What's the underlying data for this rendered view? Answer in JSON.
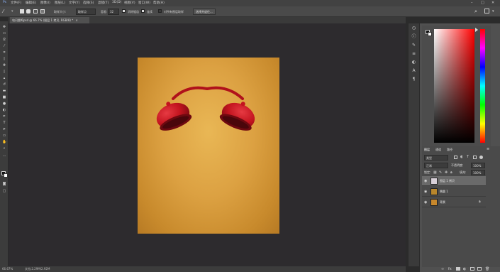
{
  "menubar": {
    "items": [
      "文件(F)",
      "编辑(E)",
      "图像(I)",
      "图层(L)",
      "文字(Y)",
      "选择(S)",
      "滤镜(T)",
      "3D(D)",
      "视图(V)",
      "窗口(W)",
      "帮助(H)"
    ],
    "minimize": "–",
    "maximize": "□",
    "close": "✕"
  },
  "options": {
    "sample_size_label": "取样大小:",
    "sample_size_value": "取样点",
    "tolerance_label": "容差:",
    "tolerance_value": "32",
    "antialias_label": "消除锯齿",
    "contiguous_label": "连续",
    "all_layers_label": "对所有图层取样",
    "refine_button": "选择并遮住..."
  },
  "document": {
    "tab_title": "电闪雷鸣psd @ 66.7% (图层 1 拷贝, RGB/8) *",
    "tab_close": "×"
  },
  "status": {
    "zoom": "66.67%",
    "doc_size": "文档:2.29M/2.92M"
  },
  "layers_panel": {
    "tabs": [
      "图层",
      "通道",
      "路径"
    ],
    "kind_filter": "类型",
    "blend_mode": "正常",
    "opacity_label": "不透明度:",
    "opacity_value": "100%",
    "lock_label": "锁定:",
    "fill_label": "填充:",
    "fill_value": "100%",
    "layers": [
      {
        "name": "图层 1 拷贝",
        "thumb_color": "#d8d0d8",
        "selected": true
      },
      {
        "name": "椭圆 1",
        "thumb_color": "#b8862c",
        "selected": false
      },
      {
        "name": "背景",
        "thumb_color": "#c8882c",
        "selected": false
      }
    ]
  },
  "colors": {
    "canvas_bg": "#d99d3e",
    "clock_red": "#c3141f"
  }
}
